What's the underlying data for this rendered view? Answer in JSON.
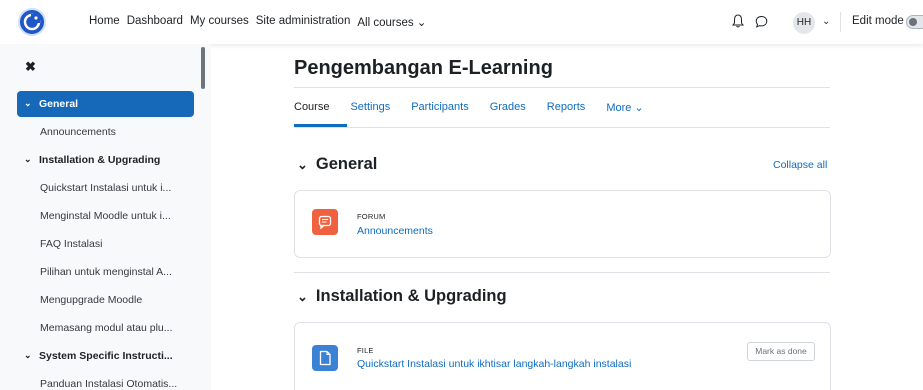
{
  "navbar": {
    "links": [
      "Home",
      "Dashboard",
      "My courses",
      "Site administration",
      "All courses ⌄"
    ],
    "user_initials": "HH",
    "edit_mode_label": "Edit mode"
  },
  "drawer": {
    "close_glyph": "✖",
    "items": [
      {
        "label": "General",
        "kind": "section",
        "active": true
      },
      {
        "label": "Announcements",
        "kind": "item"
      },
      {
        "label": "Installation & Upgrading",
        "kind": "section"
      },
      {
        "label": "Quickstart Instalasi untuk i...",
        "kind": "item"
      },
      {
        "label": "Menginstal Moodle untuk i...",
        "kind": "item"
      },
      {
        "label": "FAQ Instalasi",
        "kind": "item"
      },
      {
        "label": "Pilihan untuk menginstal A...",
        "kind": "item"
      },
      {
        "label": "Mengupgrade Moodle",
        "kind": "item"
      },
      {
        "label": "Memasang modul atau plu...",
        "kind": "item"
      },
      {
        "label": "System Specific Instructi...",
        "kind": "section"
      },
      {
        "label": "Panduan Instalasi Otomatis...",
        "kind": "item"
      }
    ]
  },
  "main": {
    "title": "Pengembangan E-Learning",
    "tabs": [
      "Course",
      "Settings",
      "Participants",
      "Grades",
      "Reports",
      "More ⌄"
    ],
    "collapse_all": "Collapse all",
    "sections": [
      {
        "title": "General",
        "activity": {
          "type": "FORUM",
          "name": "Announcements",
          "color": "#f0623f"
        }
      },
      {
        "title": "Installation & Upgrading",
        "activity": {
          "type": "FILE",
          "name": "Quickstart Instalasi untuk ikhtisar langkah-langkah instalasi",
          "color": "#3b82d4",
          "button": "Mark as done"
        }
      }
    ]
  }
}
